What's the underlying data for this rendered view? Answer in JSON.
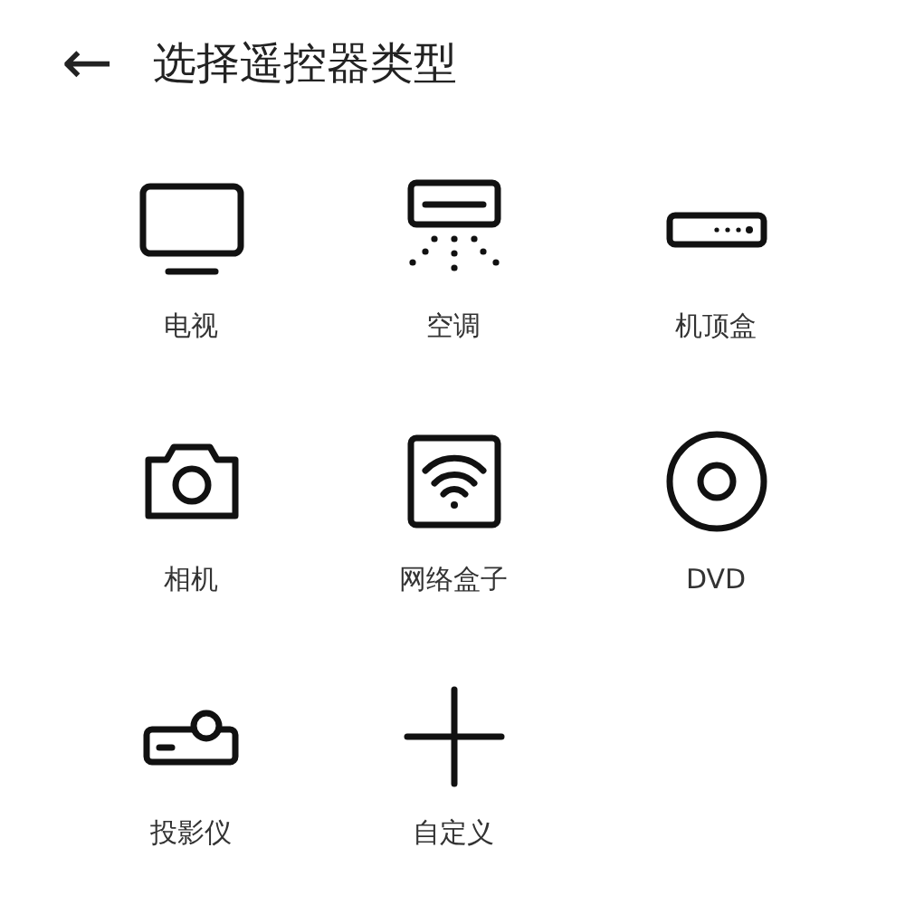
{
  "header": {
    "back_icon": "←",
    "title": "选择遥控器类型"
  },
  "items": [
    {
      "kind": "tv",
      "label": "电视"
    },
    {
      "kind": "ac",
      "label": "空调"
    },
    {
      "kind": "settop",
      "label": "机顶盒"
    },
    {
      "kind": "camera",
      "label": "相机"
    },
    {
      "kind": "netbox",
      "label": "网络盒子"
    },
    {
      "kind": "dvd",
      "label": "DVD"
    },
    {
      "kind": "projector",
      "label": "投影仪"
    },
    {
      "kind": "add",
      "label": "自定义"
    }
  ]
}
